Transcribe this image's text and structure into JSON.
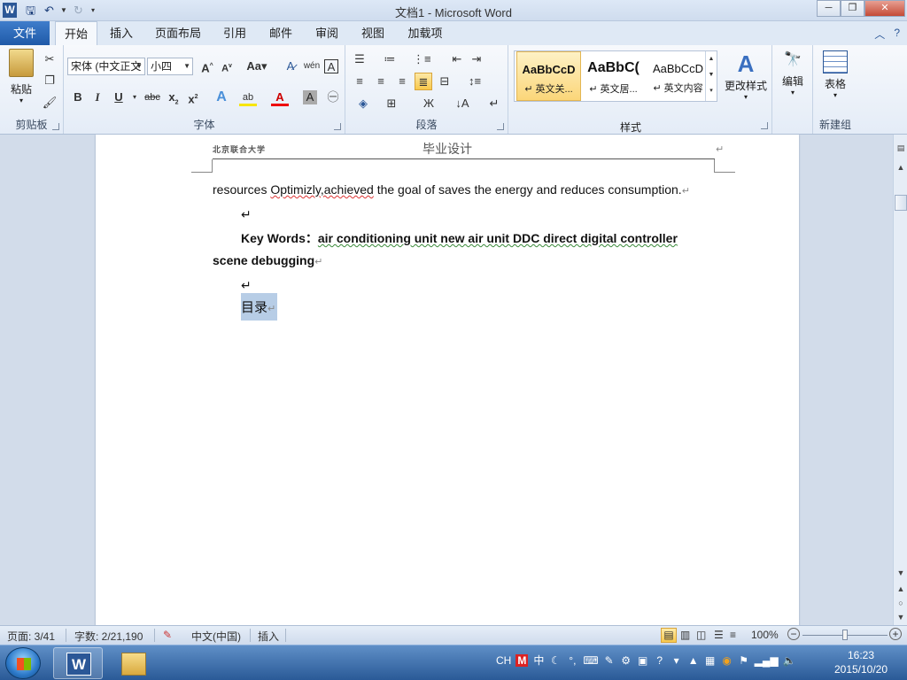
{
  "window": {
    "title": "文档1  -  Microsoft Word",
    "app_icon": "W"
  },
  "qat": {
    "save_icon": "save-icon",
    "undo_icon": "undo-icon",
    "redo_icon": "redo-icon"
  },
  "tabs": [
    {
      "label": "文件"
    },
    {
      "label": "开始"
    },
    {
      "label": "插入"
    },
    {
      "label": "页面布局"
    },
    {
      "label": "引用"
    },
    {
      "label": "邮件"
    },
    {
      "label": "审阅"
    },
    {
      "label": "视图"
    },
    {
      "label": "加载项"
    }
  ],
  "ribbon": {
    "clipboard": {
      "label": "剪贴板",
      "paste": "粘贴"
    },
    "font": {
      "label": "字体",
      "font_name": "宋体 (中文正文",
      "font_size": "小四"
    },
    "paragraph": {
      "label": "段落"
    },
    "styles": {
      "label": "样式",
      "items": [
        {
          "sample": "AaBbCcD",
          "name": "↵ 英文关..."
        },
        {
          "sample": "AaBbC(",
          "name": "↵ 英文居..."
        },
        {
          "sample": "AaBbCcD",
          "name": "↵ 英文内容"
        }
      ],
      "change_styles": "更改样式"
    },
    "editing": {
      "label": "编辑"
    },
    "newgroup": {
      "label": "新建组",
      "table": "表格"
    }
  },
  "document": {
    "header_left": "北京联合大学",
    "header_center": "毕业设计",
    "line1_a": "resources ",
    "line1_b": "Optimizly,achieved",
    "line1_c": " the  goal of saves the energy and reduces consumption.",
    "keywords_label": "Key Words",
    "keywords_colon": "：",
    "keywords_1": "air conditioning unit     new air unit     DDC       direct digital controller",
    "keywords_2": "scene debugging",
    "toc": "目录"
  },
  "status": {
    "page": "页面: 3/41",
    "words": "字数: 2/21,190",
    "language": "中文(中国)",
    "mode": "插入",
    "zoom": "100%"
  },
  "taskbar": {
    "time": "16:23",
    "date": "2015/10/20",
    "lang": "CH"
  }
}
